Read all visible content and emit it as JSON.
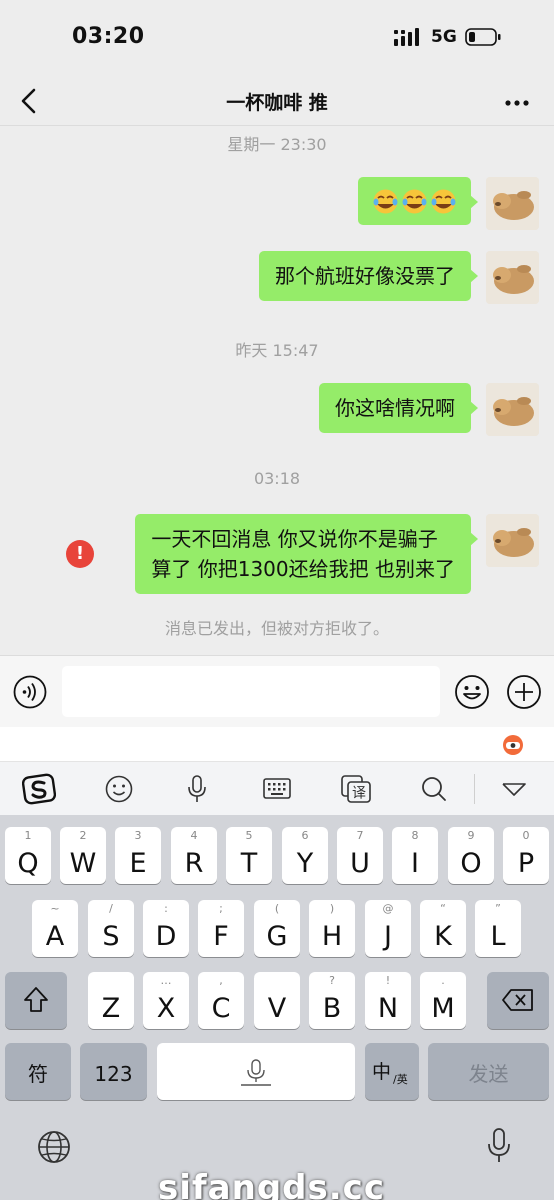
{
  "status_bar": {
    "time": "03:20",
    "network": "5G"
  },
  "nav": {
    "title": "一杯咖啡 推"
  },
  "chat": {
    "timestamps": [
      "星期一 23:30",
      "昨天 15:47",
      "03:18"
    ],
    "messages": [
      {
        "kind": "emoji",
        "emojis": [
          "rofl-emoji",
          "rofl-emoji",
          "rofl-emoji"
        ]
      },
      {
        "kind": "text",
        "lines": [
          "那个航班好像没票了"
        ]
      },
      {
        "kind": "text",
        "lines": [
          "你这啥情况啊"
        ]
      },
      {
        "kind": "text",
        "failed": true,
        "lines": [
          "一天不回消息  你又说你不是骗子",
          "算了 你把1300还给我把 也别来了"
        ]
      }
    ],
    "system_note": "消息已发出，但被对方拒收了。",
    "error_mark": "!"
  },
  "input_bar": {
    "value": "",
    "icons": [
      "voice-icon",
      "emoji-icon",
      "plus-icon"
    ]
  },
  "keyboard_toolbar": {
    "items": [
      "sogou-logo",
      "smiley-icon",
      "microphone-icon",
      "keyboard-icon",
      "translate-icon",
      "search-icon",
      "collapse-icon"
    ],
    "translate_glyph": "译"
  },
  "keyboard": {
    "row1": [
      {
        "key": "Q",
        "sub": "1"
      },
      {
        "key": "W",
        "sub": "2"
      },
      {
        "key": "E",
        "sub": "3"
      },
      {
        "key": "R",
        "sub": "4"
      },
      {
        "key": "T",
        "sub": "5"
      },
      {
        "key": "Y",
        "sub": "6"
      },
      {
        "key": "U",
        "sub": "7"
      },
      {
        "key": "I",
        "sub": "8"
      },
      {
        "key": "O",
        "sub": "9"
      },
      {
        "key": "P",
        "sub": "0"
      }
    ],
    "row2": [
      {
        "key": "A",
        "sub": "~"
      },
      {
        "key": "S",
        "sub": "/"
      },
      {
        "key": "D",
        "sub": ":"
      },
      {
        "key": "F",
        "sub": ";"
      },
      {
        "key": "G",
        "sub": "("
      },
      {
        "key": "H",
        "sub": ")"
      },
      {
        "key": "J",
        "sub": "@"
      },
      {
        "key": "K",
        "sub": "“"
      },
      {
        "key": "L",
        "sub": "”"
      }
    ],
    "row3": [
      {
        "key": "Z",
        "sub": ""
      },
      {
        "key": "X",
        "sub": "…"
      },
      {
        "key": "C",
        "sub": ","
      },
      {
        "key": "V",
        "sub": ""
      },
      {
        "key": "B",
        "sub": "?"
      },
      {
        "key": "N",
        "sub": "!"
      },
      {
        "key": "M",
        "sub": "."
      }
    ],
    "symbols_key": "符",
    "numbers_key": "123",
    "lang_key": "中",
    "lang_key_sub": "/英",
    "send_key": "发送"
  },
  "watermark": "sifangds.cc"
}
